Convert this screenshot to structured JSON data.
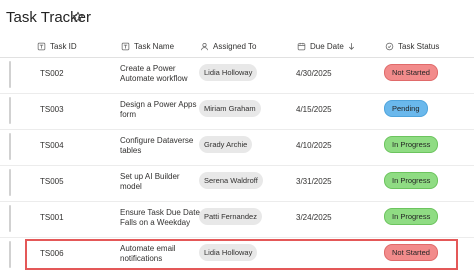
{
  "header": {
    "title": "Task Tracker"
  },
  "columns": {
    "task_id": "Task ID",
    "task_name": "Task Name",
    "assigned_to": "Assigned To",
    "due_date": "Due Date",
    "task_status": "Task Status"
  },
  "rows": [
    {
      "task_id": "TS002",
      "task_name": "Create a Power Automate workflow",
      "assigned_to": "Lidia Holloway",
      "due_date": "4/30/2025",
      "status": "Not Started",
      "status_color": "#f28b8b"
    },
    {
      "task_id": "TS003",
      "task_name": "Design a Power Apps form",
      "assigned_to": "Miriam Graham",
      "due_date": "4/15/2025",
      "status": "Pending",
      "status_color": "#6ab8ec"
    },
    {
      "task_id": "TS004",
      "task_name": "Configure Dataverse tables",
      "assigned_to": "Grady Archie",
      "due_date": "4/10/2025",
      "status": "In Progress",
      "status_color": "#8fdc83"
    },
    {
      "task_id": "TS005",
      "task_name": "Set up AI Builder model",
      "assigned_to": "Serena Waldroff",
      "due_date": "3/31/2025",
      "status": "In Progress",
      "status_color": "#8fdc83"
    },
    {
      "task_id": "TS001",
      "task_name": "Ensure Task Due Date Falls on a Weekday",
      "assigned_to": "Patti Fernandez",
      "due_date": "3/24/2025",
      "status": "In Progress",
      "status_color": "#8fdc83"
    },
    {
      "task_id": "TS006",
      "task_name": "Automate email notifications",
      "assigned_to": "Lidia Holloway",
      "due_date": "",
      "status": "Not Started",
      "status_color": "#f28b8b"
    }
  ],
  "highlight_color": "#e45858"
}
